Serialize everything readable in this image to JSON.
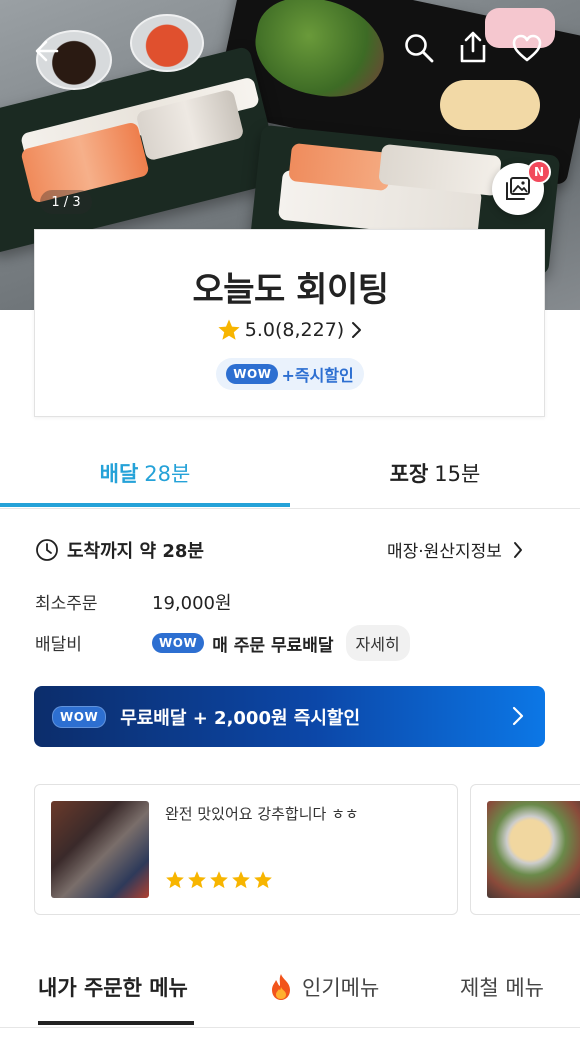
{
  "hero": {
    "photo_counter": "1 / 3",
    "new_badge": "N"
  },
  "store": {
    "name": "오늘도 회이팅",
    "rating": "5.0(8,227)",
    "wow_badge": "WOW",
    "wow_promo": "+즉시할인"
  },
  "mode_tabs": [
    {
      "label": "배달",
      "time": "28분",
      "active": true
    },
    {
      "label": "포장",
      "time": "15분",
      "active": false
    }
  ],
  "info": {
    "arrival": "도착까지 약 28분",
    "origin_link": "매장·원산지정보",
    "min_order_label": "최소주문",
    "min_order_value": "19,000원",
    "delivery_fee_label": "배달비",
    "delivery_fee_wow": "WOW",
    "delivery_fee_value": "매 주문 무료배달",
    "detail_button": "자세히"
  },
  "promo_banner": {
    "wow": "WOW",
    "text": "무료배달 + 2,000원 즉시할인"
  },
  "reviews": [
    {
      "text": "완전 맛있어요 강추합니다 ㅎㅎ",
      "stars": 5
    }
  ],
  "menu_tabs": [
    {
      "label": "내가 주문한 메뉴",
      "active": true
    },
    {
      "label": "인기메뉴",
      "icon": "fire-icon",
      "active": false
    },
    {
      "label": "제철 메뉴",
      "active": false
    }
  ],
  "colors": {
    "accent": "#25a2d8",
    "wow_blue": "#2d6fd1",
    "star": "#f7b500",
    "new_badge": "#f2495b"
  }
}
